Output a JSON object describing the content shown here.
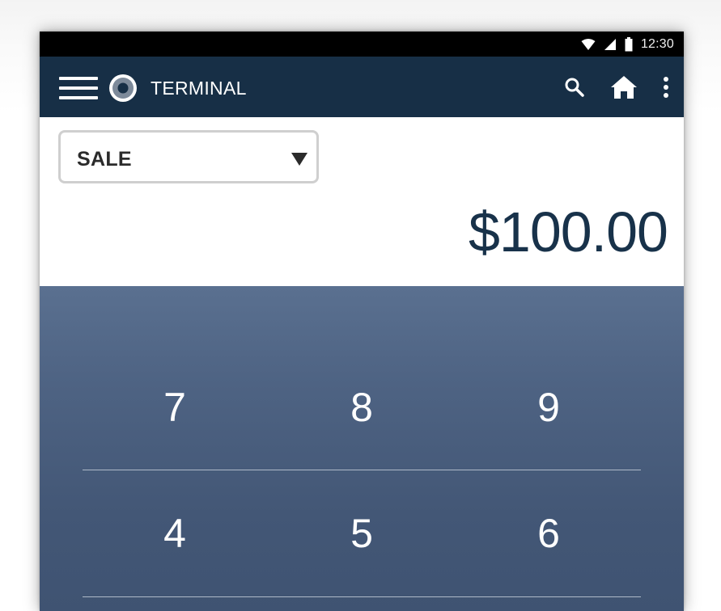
{
  "status_bar": {
    "time": "12:30",
    "icons": [
      "wifi-icon",
      "cellular-signal-icon",
      "battery-icon"
    ]
  },
  "app_bar": {
    "title": "TERMINAL",
    "menu_icon": "hamburger-menu-icon",
    "logo_icon": "ring-logo-icon",
    "actions": [
      "search-icon",
      "home-icon",
      "more-vertical-icon"
    ],
    "background_color": "#172f46"
  },
  "transaction": {
    "type_selected": "SALE",
    "dropdown_icon": "caret-down-icon",
    "amount": "$100.00",
    "amount_color": "#18324a"
  },
  "keypad": {
    "rows": [
      [
        "7",
        "8",
        "9"
      ],
      [
        "4",
        "5",
        "6"
      ]
    ],
    "background_color": "#4e6383"
  }
}
